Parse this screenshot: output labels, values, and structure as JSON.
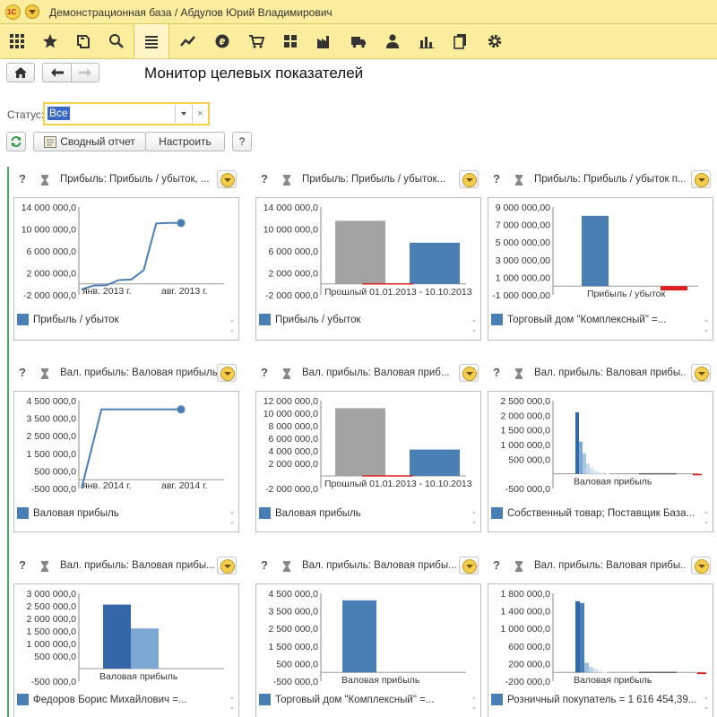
{
  "app": {
    "logo_text": "1С",
    "title": "Демонстрационная база / Абдулов Юрий Владимирович"
  },
  "sections": [
    {
      "icon": "apps-grid-icon"
    },
    {
      "icon": "star-icon"
    },
    {
      "icon": "history-icon"
    },
    {
      "icon": "search-icon"
    },
    {
      "icon": "menu-list-icon",
      "active": true
    },
    {
      "icon": "trend-icon"
    },
    {
      "icon": "finance-icon"
    },
    {
      "icon": "cart-icon"
    },
    {
      "icon": "warehouse-icon"
    },
    {
      "icon": "factory-icon"
    },
    {
      "icon": "truck-icon"
    },
    {
      "icon": "user-icon"
    },
    {
      "icon": "bar-chart-icon"
    },
    {
      "icon": "documents-icon"
    },
    {
      "icon": "gear-icon"
    }
  ],
  "page": {
    "title": "Монитор целевых показателей"
  },
  "filter": {
    "status_label": "Статус:",
    "status_value": "Все",
    "clear_label": "×"
  },
  "commands": {
    "summary_report": "Сводный отчет",
    "configure": "Настроить",
    "help": "?"
  },
  "colors": {
    "accent_bar": "#4a7fb5",
    "prior_bar": "#a3a3a3",
    "negative": "#e02020",
    "highlight": "#f2d24b",
    "section_bar": "#fbed9e"
  },
  "widgets": [
    {
      "help": "?",
      "title": "Прибыль: Прибыль / убыток, ...",
      "legend": "Прибыль / убыток",
      "chart_data": {
        "type": "line",
        "x": [
          "янв. 2013 г.",
          "",
          "",
          "",
          "",
          "",
          "",
          "авг. 2013 г."
        ],
        "xticks": [
          "янв. 2013 г.",
          "авг. 2013 г."
        ],
        "values": [
          -1000000,
          -300000,
          -250000,
          700000,
          800000,
          2500000,
          11000000,
          11100000,
          11100000
        ],
        "yticks": [
          "14 000 000,0",
          "10 000 000,0",
          "6 000 000,0",
          "2 000 000,0",
          "-2 000 000,0"
        ],
        "ylim": [
          -2000000,
          14000000
        ]
      }
    },
    {
      "help": "?",
      "title": "Прибыль: Прибыль / убыток...",
      "legend": "Прибыль / убыток",
      "chart_data": {
        "type": "bar",
        "categories": [
          "Прошлый 01.01.2013 - 10.10.2013"
        ],
        "series": [
          {
            "values": [
              11500000
            ],
            "color": "#a3a3a3"
          },
          {
            "values": [
              7500000
            ],
            "color": "#4a7fb5"
          }
        ],
        "yticks": [
          "14 000 000,0",
          "10 000 000,0",
          "6 000 000,0",
          "2 000 000,0",
          "-2 000 000,0"
        ],
        "ylim": [
          -2000000,
          14000000
        ]
      }
    },
    {
      "help": "?",
      "title": "Прибыль: Прибыль / убыток п...",
      "legend": "Торговый дом \"Комплексный\" =...",
      "chart_data": {
        "type": "bar",
        "categories": [
          "Прибыль / убыток"
        ],
        "values": [
          8000000,
          -500000
        ],
        "yticks": [
          "9 000 000,00",
          "7 000 000,00",
          "5 000 000,00",
          "3 000 000,00",
          "1 000 000,00",
          "-1 000 000,00"
        ],
        "ylim": [
          -1000000,
          9000000
        ]
      }
    },
    {
      "help": "?",
      "title": "Вал. прибыль: Валовая прибыль...",
      "legend": "Валовая прибыль",
      "chart_data": {
        "type": "line",
        "xticks": [
          "янв. 2014 г.",
          "авг. 2014 г."
        ],
        "values": [
          -500000,
          4000000,
          4000000,
          4000000,
          4000000,
          4000000
        ],
        "yticks": [
          "4 500 000,0",
          "3 500 000,0",
          "2 500 000,0",
          "1 500 000,0",
          "500 000,0",
          "-500 000,0"
        ],
        "ylim": [
          -500000,
          4500000
        ]
      }
    },
    {
      "help": "?",
      "title": "Вал. прибыль: Валовая приб...",
      "legend": "Валовая прибыль",
      "chart_data": {
        "type": "bar",
        "categories": [
          "Прошлый 01.01.2013 - 10.10.2013"
        ],
        "series": [
          {
            "values": [
              10800000
            ],
            "color": "#a3a3a3"
          },
          {
            "values": [
              4200000
            ],
            "color": "#4a7fb5"
          }
        ],
        "yticks": [
          "12 000 000,0",
          "10 000 000,0",
          "8 000 000,0",
          "6 000 000,0",
          "4 000 000,0",
          "2 000 000,0",
          "",
          "-2 000 000,0"
        ],
        "ylim": [
          -2000000,
          12000000
        ]
      }
    },
    {
      "help": "?",
      "title": "Вал. прибыль: Валовая прибы...",
      "legend": "Собственный товар; Поставщик База...",
      "chart_data": {
        "type": "bar",
        "categories": [
          "Валовая прибыль"
        ],
        "values": [
          2100000,
          1100000,
          700000,
          350000,
          200000,
          120000,
          80000,
          50000,
          20000,
          -50000
        ],
        "yticks": [
          "2 500 000,0",
          "2 000 000,0",
          "1 500 000,0",
          "1 000 000,0",
          "500 000,0",
          "",
          "-500 000,0"
        ],
        "ylim": [
          -500000,
          2500000
        ]
      }
    },
    {
      "help": "?",
      "title": "Вал. прибыль: Валовая прибы...",
      "legend": "Федоров Борис Михайлович =...",
      "chart_data": {
        "type": "bar",
        "categories": [
          "Валовая прибыль"
        ],
        "values": [
          2550000,
          1600000
        ],
        "yticks": [
          "3 000 000,0",
          "2 500 000,0",
          "2 000 000,0",
          "1 500 000,0",
          "1 000 000,0",
          "500 000,0",
          "",
          "-500 000,0"
        ],
        "ylim": [
          -500000,
          3000000
        ]
      }
    },
    {
      "help": "?",
      "title": "Вал. прибыль: Валовая прибы...",
      "legend": "Торговый дом \"Комплексный\" =...",
      "chart_data": {
        "type": "bar",
        "categories": [
          "Валовая прибыль"
        ],
        "values": [
          4100000
        ],
        "yticks": [
          "4 500 000,0",
          "3 500 000,0",
          "2 500 000,0",
          "1 500 000,0",
          "500 000,0",
          "-500 000,0"
        ],
        "ylim": [
          -500000,
          4500000
        ]
      }
    },
    {
      "help": "?",
      "title": "Вал. прибыль: Валовая прибы...",
      "legend": "Розничный покупатель = 1 616 454,39...",
      "chart_data": {
        "type": "bar",
        "categories": [
          "Валовая прибыль"
        ],
        "values": [
          1620000,
          1580000,
          220000,
          120000,
          80000,
          40000,
          20000,
          -40000
        ],
        "yticks": [
          "1 800 000,0",
          "1 400 000,0",
          "1 000 000,0",
          "600 000,0",
          "200 000,0",
          "-200 000,0"
        ],
        "ylim": [
          -200000,
          1800000
        ]
      }
    }
  ]
}
